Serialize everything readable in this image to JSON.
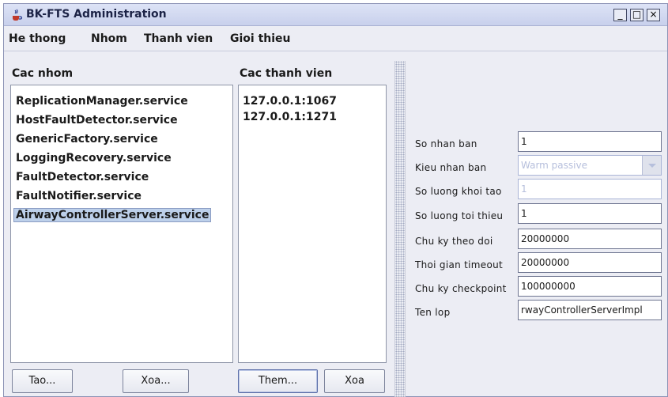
{
  "window": {
    "title": "BK-FTS Administration",
    "controls": {
      "minimize": "_",
      "maximize": "□",
      "close": "×"
    }
  },
  "menu": {
    "items": [
      "He thong",
      "Nhom",
      "Thanh vien",
      "Gioi thieu"
    ]
  },
  "groups": {
    "header": "Cac nhom",
    "items": [
      "ReplicationManager.service",
      "HostFaultDetector.service",
      "GenericFactory.service",
      "LoggingRecovery.service",
      "FaultDetector.service",
      "FaultNotifier.service",
      "AirwayControllerServer.service"
    ],
    "selected": "AirwayControllerServer.service",
    "create_button": "Tao...",
    "delete_button": "Xoa..."
  },
  "members": {
    "header": "Cac thanh vien",
    "items": [
      "127.0.0.1:1067",
      "127.0.0.1:1271"
    ],
    "add_button": "Them...",
    "delete_button": "Xoa"
  },
  "properties": {
    "replica_count": {
      "label": "So nhan ban",
      "value": "1"
    },
    "replication_style": {
      "label": "Kieu nhan ban",
      "value": "Warm passive"
    },
    "initial_count": {
      "label": "So luong khoi tao",
      "value": "1"
    },
    "minimum_count": {
      "label": "So luong toi thieu",
      "value": "1"
    },
    "monitor_period": {
      "label": "Chu ky theo doi",
      "value": "20000000"
    },
    "timeout": {
      "label": "Thoi gian timeout",
      "value": "20000000"
    },
    "checkpoint_period": {
      "label": "Chu ky checkpoint",
      "value": "100000000"
    },
    "class_name": {
      "label": "Ten lop",
      "value": "rwayControllerServerImpl"
    }
  },
  "colors": {
    "title_bar": "#c8d0ec",
    "selection": "#bdd0ea",
    "disabled_text": "#b6bfdc",
    "panel_bg": "#ecedf4"
  },
  "icons": {
    "app": "java-cup-icon",
    "dropdown": "chevron-down-icon"
  }
}
